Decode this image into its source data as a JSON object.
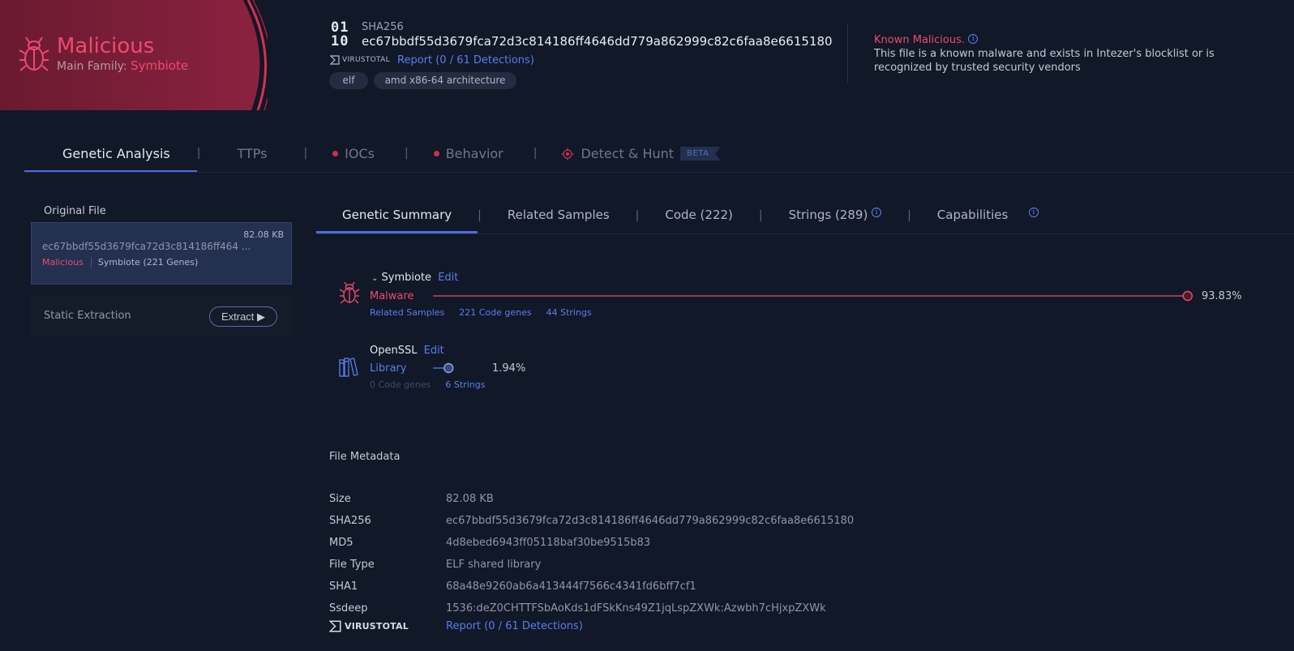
{
  "verdict": {
    "title": "Malicious",
    "family_label": "Main Family:",
    "family": "Symbiote",
    "icon": "bug-icon",
    "color": "#ee4a6e"
  },
  "header": {
    "sha_label": "SHA256",
    "sha_value": "ec67bbdf55d3679fca72d3c814186ff4646dd779a862999c82c6faa8e6615180",
    "binary_icon": "binary-file-icon",
    "virustotal_label": "VIRUSTOTAL",
    "virustotal_report": "Report (0 / 61 Detections)",
    "tags": [
      "elf",
      "amd x86-64 architecture"
    ]
  },
  "known": {
    "title": "Known Malicious.",
    "description": "This file is a known malware and exists in Intezer's blocklist or is recognized by trusted security vendors"
  },
  "main_tabs": [
    {
      "label": "Genetic Analysis"
    },
    {
      "label": "TTPs"
    },
    {
      "label": "IOCs"
    },
    {
      "label": "Behavior"
    },
    {
      "label": "Detect & Hunt",
      "badge": "BETA"
    }
  ],
  "left": {
    "original_label": "Original File",
    "file": {
      "size": "82.08 KB",
      "hash": "ec67bbdf55d3679fca72d3c814186ff464  ...",
      "verdict": "Malicious",
      "family": "Symbiote (221 Genes)"
    },
    "static_label": "Static Extraction",
    "extract_label": "Extract"
  },
  "sub_tabs": [
    {
      "label": "Genetic Summary"
    },
    {
      "label": "Related Samples"
    },
    {
      "label": "Code (222)"
    },
    {
      "label": "Strings (289)"
    },
    {
      "label": "Capabilities"
    }
  ],
  "genes": [
    {
      "name": "Symbiote",
      "edit": "Edit",
      "kind": "Malware",
      "kind_color": "#ee4a6e",
      "percent_label": "93.83%",
      "percent": 93.83,
      "links": [
        "Related Samples",
        "221 Code genes",
        "44 Strings"
      ]
    },
    {
      "name": "OpenSSL",
      "edit": "Edit",
      "kind": "Library",
      "kind_color": "#5a7ef0",
      "percent_label": "1.94%",
      "percent": 1.94,
      "links": [
        "0 Code genes",
        "6 Strings"
      ]
    }
  ],
  "metadata": {
    "title": "File Metadata",
    "rows": [
      {
        "key": "Size",
        "value": "82.08 KB"
      },
      {
        "key": "SHA256",
        "value": "ec67bbdf55d3679fca72d3c814186ff4646dd779a862999c82c6faa8e6615180"
      },
      {
        "key": "MD5",
        "value": "4d8ebed6943ff05118baf30be9515b83"
      },
      {
        "key": "File Type",
        "value": "ELF shared library"
      },
      {
        "key": "SHA1",
        "value": "68a48e9260ab6a413444f7566c4341fd6bff7cf1"
      },
      {
        "key": "Ssdeep",
        "value": "1536:deZ0CHTTFSbAoKds1dFSkKns49Z1jqLspZXWk:Azwbh7cHjxpZXWk"
      }
    ],
    "virustotal_label": "VIRUSTOTAL",
    "virustotal_report": "Report (0 / 61 Detections)"
  }
}
